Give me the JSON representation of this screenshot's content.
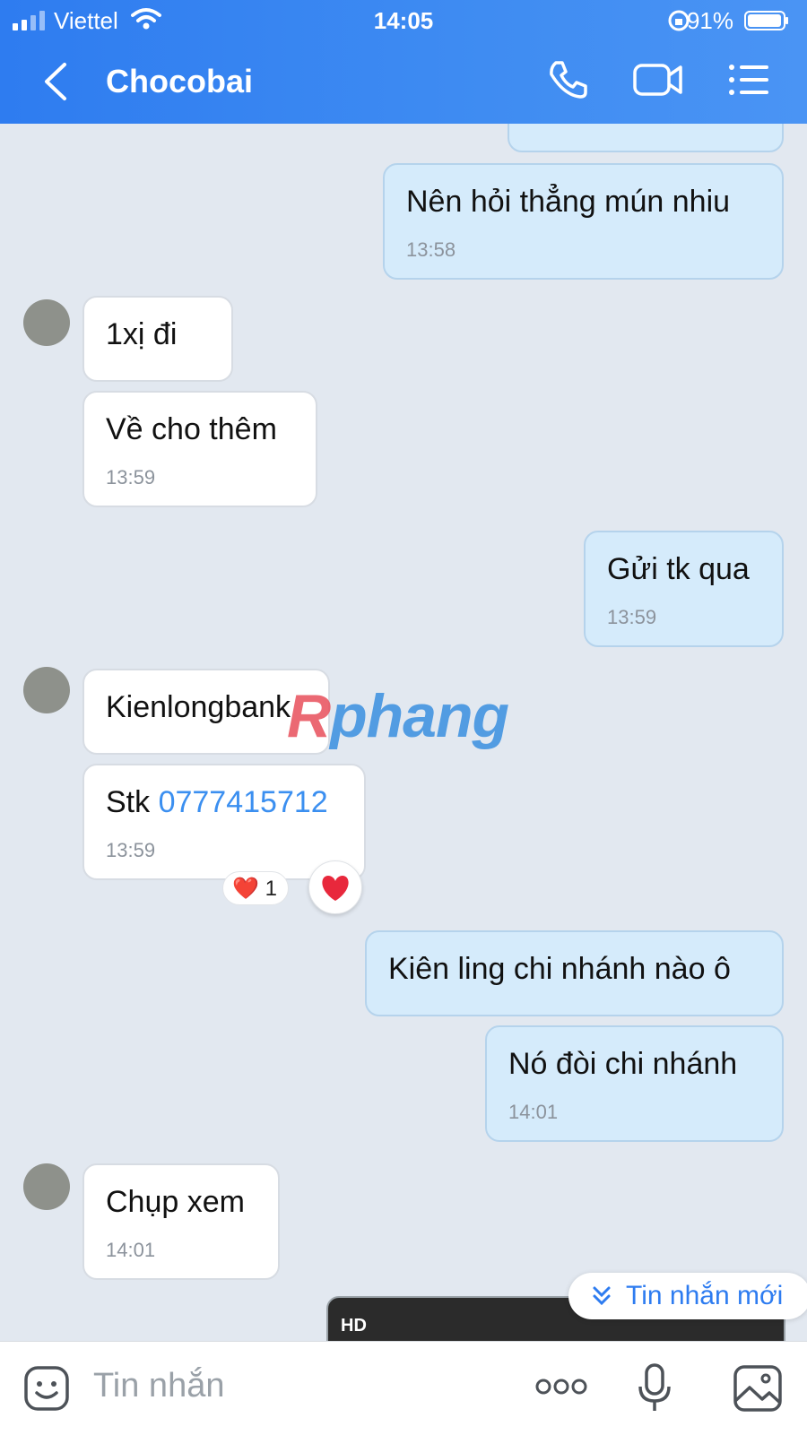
{
  "status_bar": {
    "carrier": "Viettel",
    "time": "14:05",
    "battery": "91%"
  },
  "header": {
    "title": "Chocobai"
  },
  "messages": [
    {
      "from": "me",
      "text": "Nên hỏi thẳng mún nhiu",
      "time": "13:58"
    },
    {
      "from": "them",
      "text": "1xị đi"
    },
    {
      "from": "them",
      "text": "Về cho thêm",
      "time": "13:59"
    },
    {
      "from": "me",
      "text": "Gửi tk qua",
      "time": "13:59"
    },
    {
      "from": "them",
      "text": "Kienlongbank"
    },
    {
      "from": "them",
      "text_prefix": "Stk ",
      "link": "0777415712",
      "time": "13:59",
      "reaction": {
        "emoji": "❤️",
        "count": "1"
      }
    },
    {
      "from": "me",
      "text": "Kiên ling chi nhánh nào ô"
    },
    {
      "from": "me",
      "text": "Nó đòi chi nhánh",
      "time": "14:01"
    },
    {
      "from": "them",
      "text": "Chụp xem",
      "time": "14:01"
    }
  ],
  "video": {
    "badge": "HD"
  },
  "watermark": {
    "part1": "R",
    "part2": "phang"
  },
  "new_message_button": {
    "label": "Tin nhắn mới"
  },
  "composer": {
    "placeholder": "Tin nhắn"
  },
  "icons": [
    "back-icon",
    "phone-icon",
    "video-call-icon",
    "menu-icon",
    "emoji-icon",
    "more-icon",
    "mic-icon",
    "image-icon",
    "heart-icon"
  ],
  "colors": {
    "header": "#2e7cf0",
    "outgoing_bubble": "#d5ebfb",
    "incoming_bubble": "#ffffff",
    "chat_bg": "#e2e8f0",
    "link": "#3b8ff0",
    "heart": "#e8283c"
  }
}
